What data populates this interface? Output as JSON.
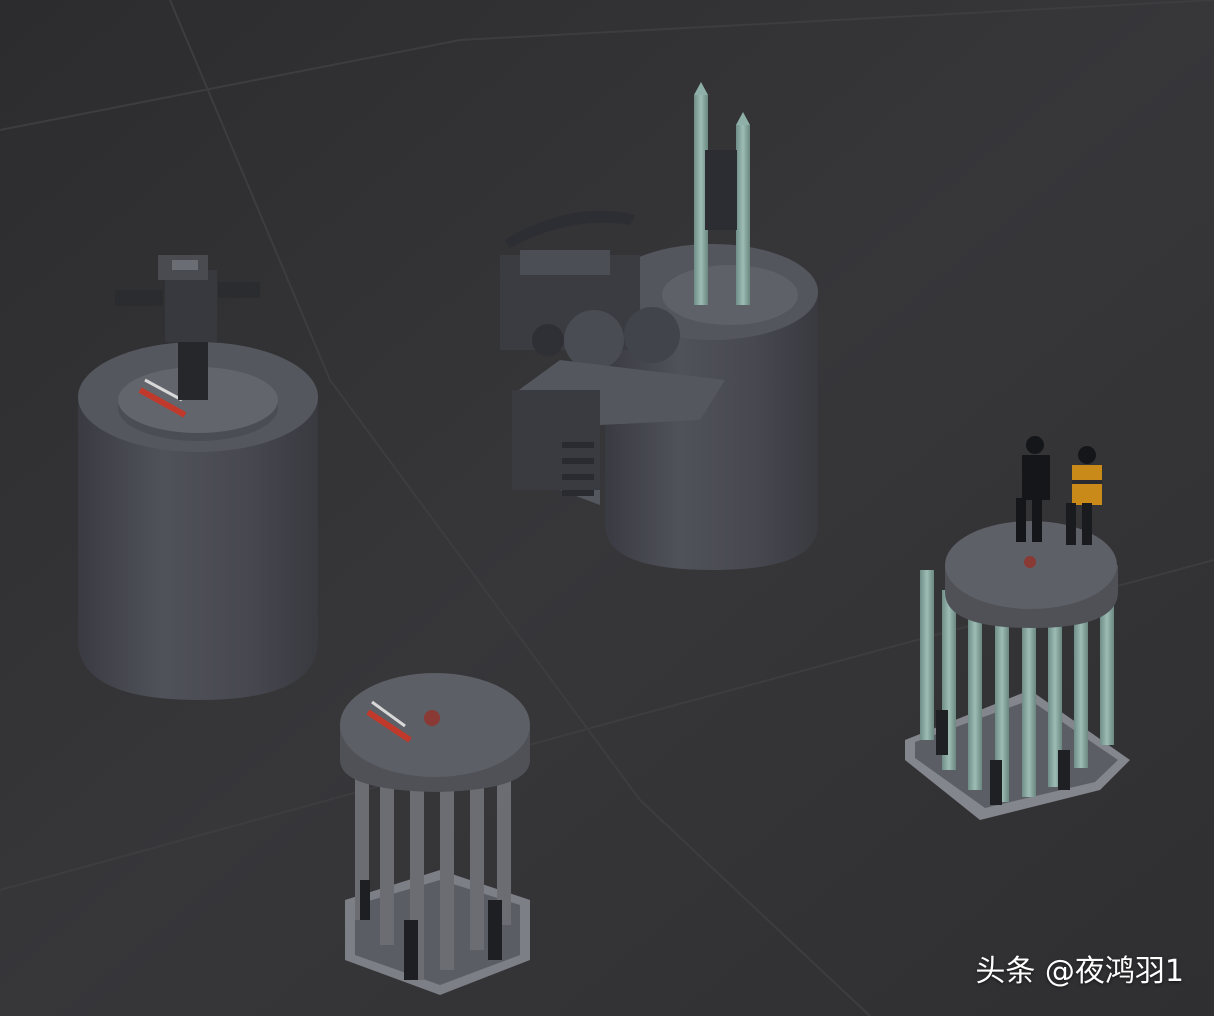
{
  "scene": {
    "description_objects": [
      "gun-turret-cylinder",
      "radar-turret-module",
      "missile-launcher-small",
      "missile-launcher-with-figures"
    ]
  },
  "watermark": {
    "text": "头条 @夜鸿羽1"
  },
  "colors": {
    "background": "#333335",
    "cylinder": "#4a4b52",
    "cylinder_top": "#5a5b62",
    "missile": "#8fb0a8",
    "accent_red": "#c0392b"
  }
}
